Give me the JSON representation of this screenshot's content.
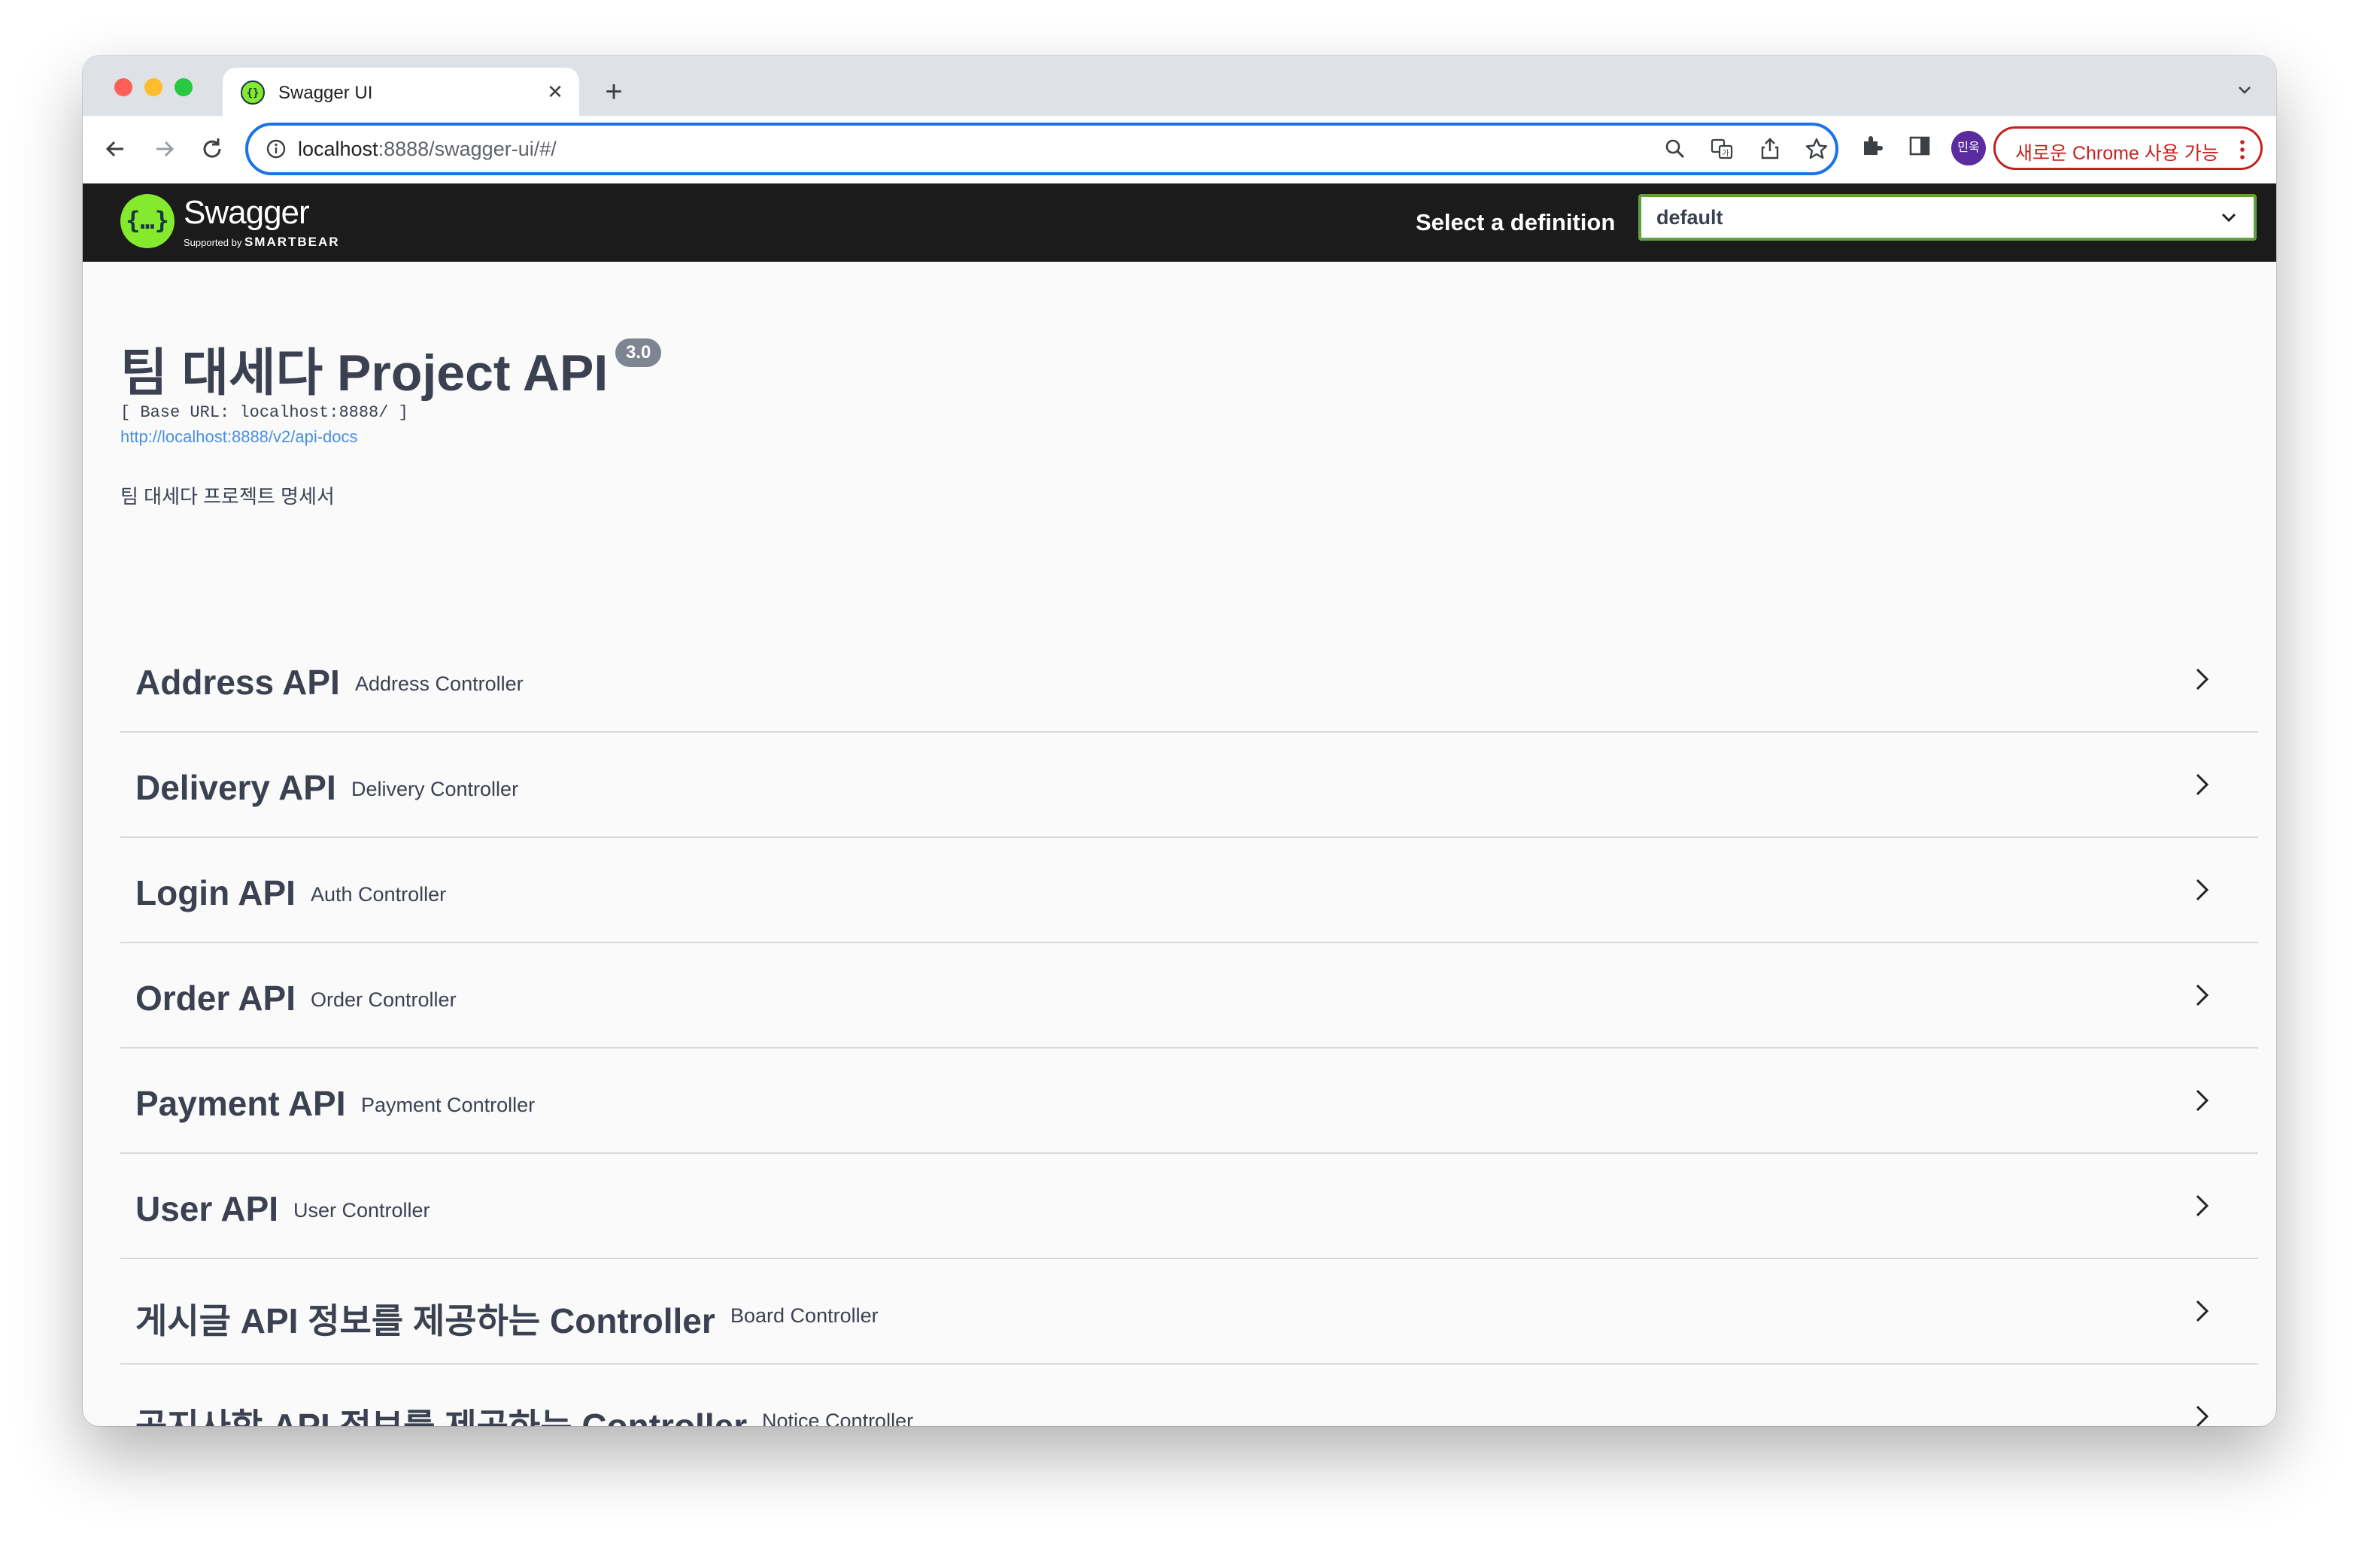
{
  "browser": {
    "tab_title": "Swagger UI",
    "tab_close": "✕",
    "new_tab": "+",
    "url_host": "localhost",
    "url_rest": ":8888/swagger-ui/#/",
    "profile_initials": "민욱",
    "update_label": "새로운 Chrome 사용 가능",
    "icons": [
      "back-icon",
      "forward-icon",
      "reload-icon",
      "info-icon",
      "zoom-icon",
      "translate-icon",
      "share-icon",
      "star-icon",
      "extensions-icon",
      "side-panel-icon",
      "menu-dots-icon"
    ]
  },
  "topbar": {
    "brand": "Swagger",
    "brand_sub_prefix": "Supported by",
    "brand_sub_name": "SMARTBEAR",
    "definition_label": "Select a definition",
    "definition_value": "default",
    "colors": {
      "background": "#1b1b1b",
      "logo": "#85ea2d",
      "select_border": "#62a03f"
    }
  },
  "info": {
    "title": "팀 대세다 Project API",
    "version": "3.0",
    "base_url": "[ Base URL: localhost:8888/ ]",
    "docs_link": "http://localhost:8888/v2/api-docs",
    "description": "팀 대세다 프로젝트 명세서"
  },
  "tags": [
    {
      "name": "Address API",
      "description": "Address Controller"
    },
    {
      "name": "Delivery API",
      "description": "Delivery Controller"
    },
    {
      "name": "Login API",
      "description": "Auth Controller"
    },
    {
      "name": "Order API",
      "description": "Order Controller"
    },
    {
      "name": "Payment API",
      "description": "Payment Controller"
    },
    {
      "name": "User API",
      "description": "User Controller"
    },
    {
      "name": "게시글 API 정보를 제공하는 Controller",
      "description": "Board Controller"
    },
    {
      "name": "공지사항 API 정보를 제공하는 Controller",
      "description": "Notice Controller"
    }
  ]
}
